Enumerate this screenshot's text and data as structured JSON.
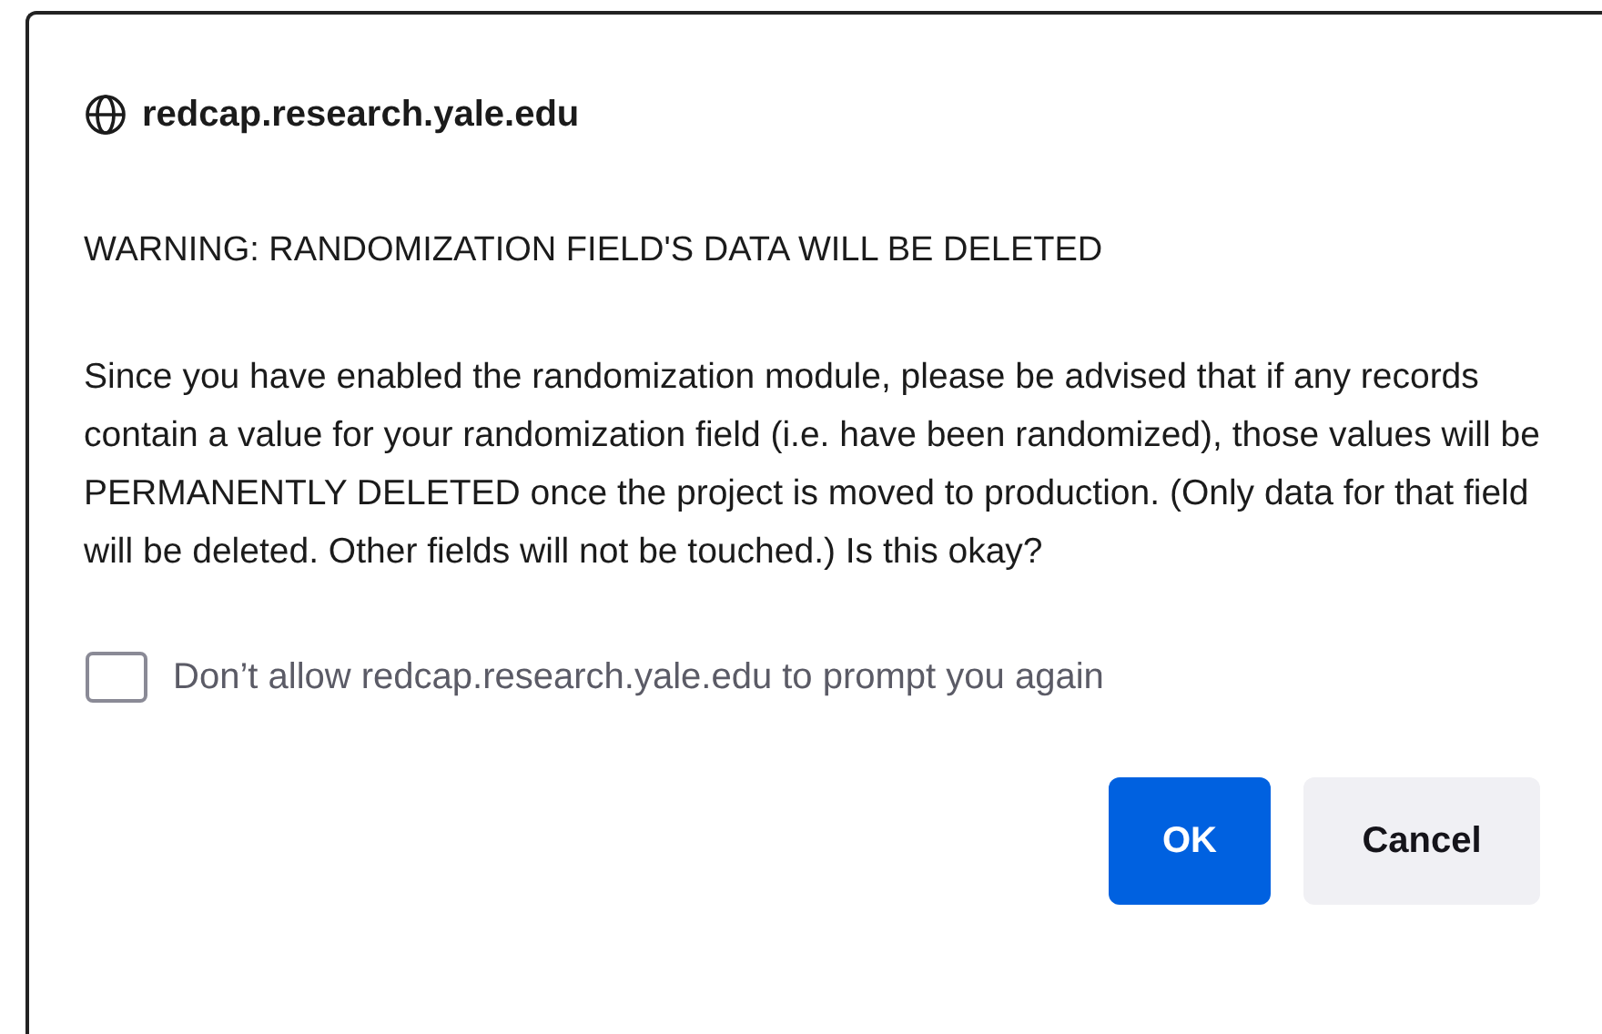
{
  "dialog": {
    "origin": "redcap.research.yale.edu",
    "heading": "WARNING: RANDOMIZATION FIELD'S DATA WILL BE DELETED",
    "message": "Since you have enabled the randomization module, please be advised that if any records contain a value for your randomization field (i.e. have been randomized), those values will be PERMANENTLY DELETED once the project is moved to production. (Only data for that field will be deleted. Other fields will not be touched.) Is this okay?",
    "checkbox": {
      "label": "Don’t allow redcap.research.yale.edu to prompt you again",
      "checked": false
    },
    "buttons": [
      {
        "label": "OK",
        "kind": "primary"
      },
      {
        "label": "Cancel",
        "kind": "secondary"
      }
    ]
  }
}
